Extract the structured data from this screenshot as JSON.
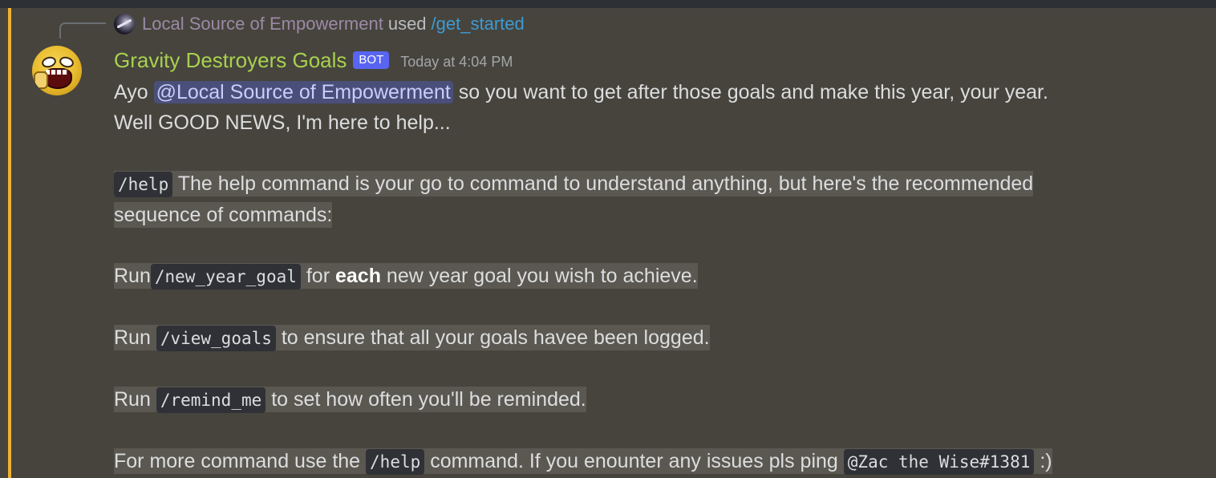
{
  "reply": {
    "user": "Local Source of Empowerment",
    "used_text": "used",
    "command": "/get_started"
  },
  "author": {
    "name": "Gravity Destroyers Goals",
    "tag": "BOT",
    "timestamp": "Today at 4:04 PM"
  },
  "message": {
    "l1_pre": "Ayo",
    "l1_mention": "@Local Source of Empowerment",
    "l1_post": "so you want to get after those goals and make this year, your year.",
    "l2": "Well GOOD NEWS, I'm here to help...",
    "l3_code": "/help",
    "l3_text": "The help command is your go to command to understand anything, but here's the recommended",
    "l4": "sequence of commands:",
    "l5_run": "Run",
    "l5_code": "/new_year_goal",
    "l5_pre": "for",
    "l5_bold": "each",
    "l5_post": "new year goal you wish to achieve.",
    "l6_run": "Run",
    "l6_code": "/view_goals",
    "l6_post": "to ensure that all your goals havee been logged.",
    "l7_run": "Run",
    "l7_code": "/remind_me",
    "l7_post": "to set how often you'll be reminded.",
    "l8_pre": "For more command use the",
    "l8_code": "/help",
    "l8_mid": "command. If you enounter any issues pls ping",
    "l8_code2": "@Zac the Wise#1381",
    "l8_post": ":)"
  },
  "colors": {
    "background": "#46443d",
    "mention_bar": "#f0b132",
    "username": "#a8d14f",
    "bot_tag": "#5865f2",
    "command_link": "#3d9bd4",
    "mention_bg": "#4a4f7a"
  },
  "icons": {
    "reply_avatar": "galaxy-avatar",
    "author_avatar": "screaming-face-avatar"
  }
}
